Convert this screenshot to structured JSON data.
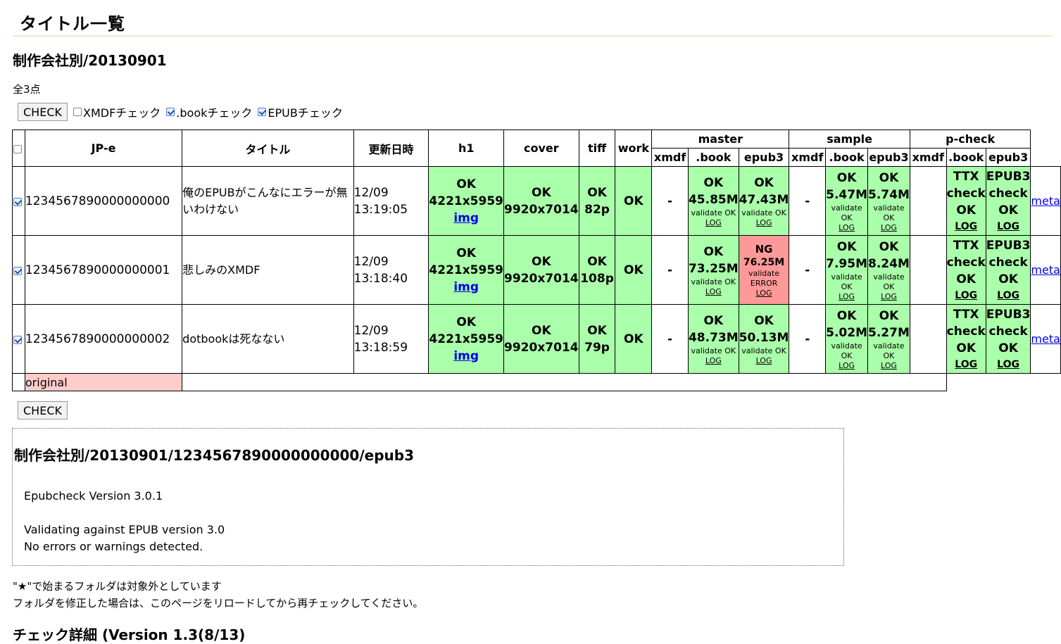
{
  "page_title": "タイトル一覧",
  "section_title": "制作会社別/20130901",
  "count": "全3点",
  "controls": {
    "check_label": "CHECK",
    "xmdf_label": "XMDFチェック",
    "book_label": ".bookチェック",
    "epub_label": "EPUBチェック",
    "xmdf_checked": false,
    "book_checked": true,
    "epub_checked": true
  },
  "headers": {
    "jpe": "JP-e",
    "title": "タイトル",
    "updated": "更新日時",
    "h1": "h1",
    "cover": "cover",
    "tiff": "tiff",
    "work": "work",
    "master": "master",
    "sample": "sample",
    "pcheck": "p-check",
    "xmdf": "xmdf",
    "book": ".book",
    "epub3": "epub3"
  },
  "rows": [
    {
      "id": "1234567890000000000",
      "title": "俺のEPUBがこんなにエラーが無いわけない",
      "date": "12/09",
      "time": "13:19:05",
      "h1_status": "OK",
      "h1_size": "4221x5959",
      "h1_link": "img",
      "cover_status": "OK",
      "cover_size": "9920x7014",
      "tiff_status": "OK",
      "tiff_pages": "82p",
      "work": "OK",
      "m_xmdf": "-",
      "m_book_status": "OK",
      "m_book_size": "45.85M",
      "m_book_valid": "validate OK",
      "m_book_log": "LOG",
      "m_epub_status": "OK",
      "m_epub_size": "47.43M",
      "m_epub_valid": "validate OK",
      "m_epub_log": "LOG",
      "s_xmdf": "-",
      "s_book_status": "OK",
      "s_book_size": "5.47M",
      "s_book_valid1": "validate",
      "s_book_valid2": "OK",
      "s_book_log": "LOG",
      "s_epub_status": "OK",
      "s_epub_size": "5.74M",
      "s_epub_valid": "validate OK",
      "s_epub_log": "LOG",
      "p_book_1": "TTX",
      "p_book_2": "check",
      "p_book_3": "OK",
      "p_book_log": "LOG",
      "p_epub_1": "EPUB3",
      "p_epub_2": "check",
      "p_epub_3": "OK",
      "p_epub_log": "LOG",
      "meta": "meta"
    },
    {
      "id": "1234567890000000001",
      "title": "悲しみのXMDF",
      "date": "12/09",
      "time": "13:18:40",
      "h1_status": "OK",
      "h1_size": "4221x5959",
      "h1_link": "img",
      "cover_status": "OK",
      "cover_size": "9920x7014",
      "tiff_status": "OK",
      "tiff_pages": "108p",
      "work": "OK",
      "m_xmdf": "-",
      "m_book_status": "OK",
      "m_book_size": "73.25M",
      "m_book_valid": "validate OK",
      "m_book_log": "LOG",
      "m_epub_status": "NG",
      "m_epub_size": "76.25M",
      "m_epub_valid1": "validate",
      "m_epub_valid2": "ERROR",
      "m_epub_log": "LOG",
      "s_xmdf": "-",
      "s_book_status": "OK",
      "s_book_size": "7.95M",
      "s_book_valid1": "validate",
      "s_book_valid2": "OK",
      "s_book_log": "LOG",
      "s_epub_status": "OK",
      "s_epub_size": "8.24M",
      "s_epub_valid": "validate OK",
      "s_epub_log": "LOG",
      "p_book_1": "TTX",
      "p_book_2": "check",
      "p_book_3": "OK",
      "p_book_log": "LOG",
      "p_epub_1": "EPUB3",
      "p_epub_2": "check",
      "p_epub_3": "OK",
      "p_epub_log": "LOG",
      "meta": "meta"
    },
    {
      "id": "1234567890000000002",
      "title": "dotbookは死なない",
      "date": "12/09",
      "time": "13:18:59",
      "h1_status": "OK",
      "h1_size": "4221x5959",
      "h1_link": "img",
      "cover_status": "OK",
      "cover_size": "9920x7014",
      "tiff_status": "OK",
      "tiff_pages": "79p",
      "work": "OK",
      "m_xmdf": "-",
      "m_book_status": "OK",
      "m_book_size": "48.73M",
      "m_book_valid": "validate OK",
      "m_book_log": "LOG",
      "m_epub_status": "OK",
      "m_epub_size": "50.13M",
      "m_epub_valid": "validate OK",
      "m_epub_log": "LOG",
      "s_xmdf": "-",
      "s_book_status": "OK",
      "s_book_size": "5.02M",
      "s_book_valid1": "validate",
      "s_book_valid2": "OK",
      "s_book_log": "LOG",
      "s_epub_status": "OK",
      "s_epub_size": "5.27M",
      "s_epub_valid": "validate OK",
      "s_epub_log": "LOG",
      "p_book_1": "TTX",
      "p_book_2": "check",
      "p_book_3": "OK",
      "p_book_log": "LOG",
      "p_epub_1": "EPUB3",
      "p_epub_2": "check",
      "p_epub_3": "OK",
      "p_epub_log": "LOG",
      "meta": "meta"
    }
  ],
  "original_label": "original",
  "log": {
    "heading": "制作会社別/20130901/1234567890000000000/epub3",
    "line1": "Epubcheck Version 3.0.1",
    "line2": "Validating against EPUB version 3.0",
    "line3": "No errors or warnings detected."
  },
  "notes": {
    "line1": "\"★\"で始まるフォルダは対象外としています",
    "line2": "フォルダを修正した場合は、このページをリロードしてから再チェックしてください。"
  },
  "details_title": "チェック詳細 (Version 1.3(8/13)",
  "colors": {
    "ok": "#aaffaa",
    "ng": "#ff9999",
    "original": "#ffcccc",
    "rule": "#f0e6d2"
  }
}
